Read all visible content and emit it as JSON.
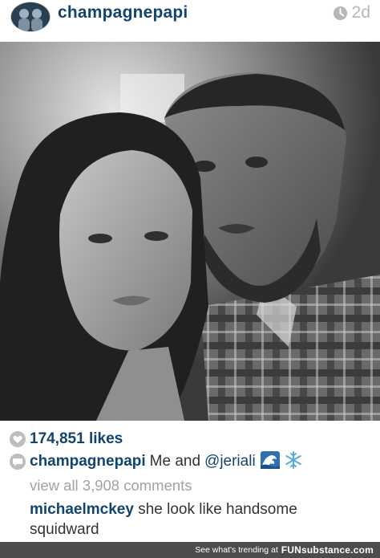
{
  "post": {
    "username": "champagnepapi",
    "timestamp": "2d",
    "likes": "174,851 likes",
    "caption": {
      "user": "champagnepapi",
      "text": "Me and",
      "mention": "@jeriali",
      "emojis": [
        "wave-emoji",
        "snowflake-emoji"
      ]
    },
    "view_all_comments": "view all 3,908 comments",
    "comments": [
      {
        "user": "michaelmckey",
        "text": "she look like handsome squidward"
      }
    ]
  },
  "footer": {
    "text": "See what's trending at",
    "brand": "FUNsubstance.com"
  },
  "colors": {
    "username": "#12446f",
    "muted": "#a3a3a3",
    "footer_bg": "#4c4c4c"
  }
}
